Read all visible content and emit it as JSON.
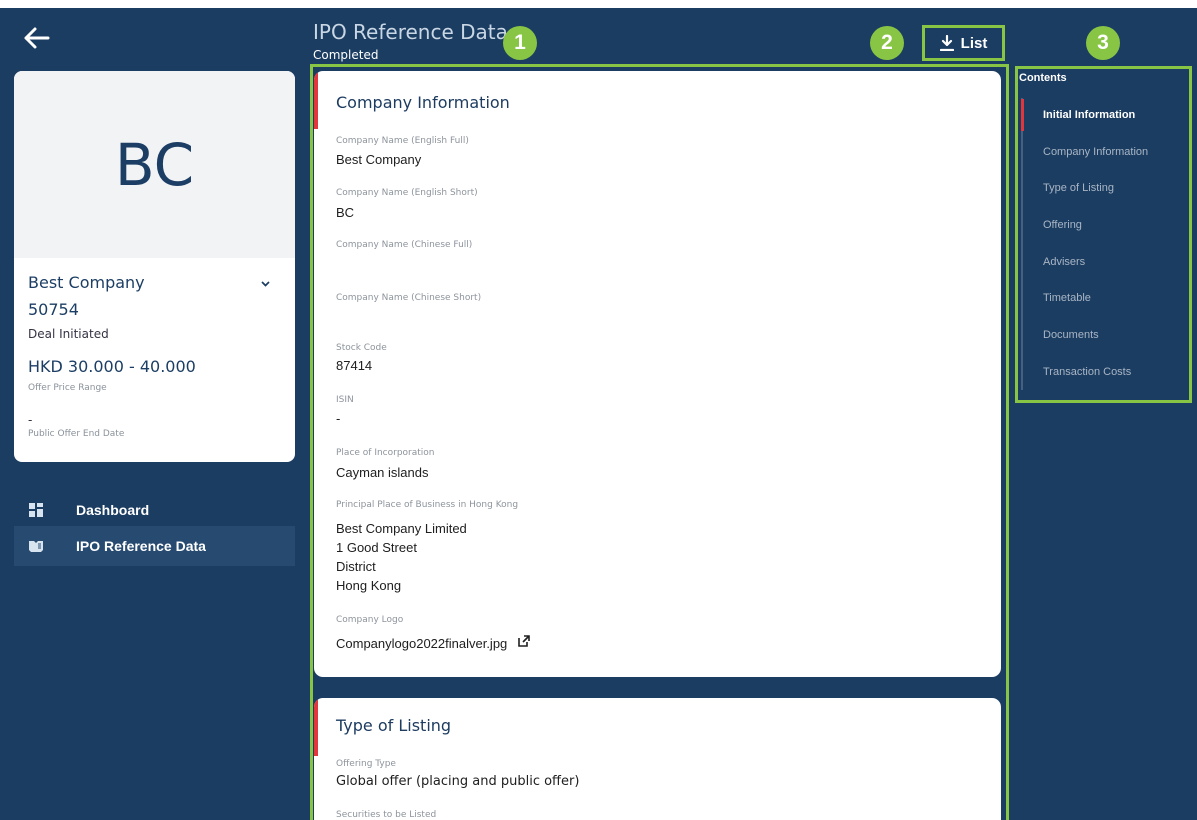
{
  "header": {
    "title": "IPO Reference Data",
    "status": "Completed",
    "list_label": "List"
  },
  "annotations": [
    "1",
    "2",
    "3"
  ],
  "profile": {
    "initials": "BC",
    "company_name": "Best Company",
    "deal_id": "50754",
    "deal_status": "Deal Initiated",
    "offer_price_range": "HKD 30.000 - 40.000",
    "offer_price_range_label": "Offer Price Range",
    "public_offer_end_date": "-",
    "public_offer_end_date_label": "Public Offer End Date"
  },
  "nav": [
    {
      "label": "Dashboard",
      "icon": "grid-icon"
    },
    {
      "label": "IPO Reference Data",
      "icon": "book-icon"
    }
  ],
  "company_information": {
    "title": "Company Information",
    "fields": [
      {
        "label": "Company Name (English Full)",
        "value": "Best Company"
      },
      {
        "label": "Company Name (English Short)",
        "value": "BC"
      },
      {
        "label": "Company Name (Chinese Full)",
        "value": ""
      },
      {
        "label": "Company Name (Chinese Short)",
        "value": ""
      },
      {
        "label": "Stock Code",
        "value": "87414"
      },
      {
        "label": "ISIN",
        "value": "-"
      },
      {
        "label": "Place of Incorporation",
        "value": "Cayman islands"
      },
      {
        "label": "Principal Place of Business in Hong Kong",
        "lines": [
          "Best Company Limited",
          "1 Good Street",
          "District",
          "Hong Kong"
        ]
      },
      {
        "label": "Company Logo",
        "value": "Companylogo2022finalver.jpg"
      }
    ]
  },
  "type_of_listing": {
    "title": "Type of Listing",
    "offering_type_label": "Offering Type",
    "offering_type": "Global offer (placing and public offer)",
    "securities_label": "Securities to be Listed"
  },
  "contents": {
    "title": "Contents",
    "items": [
      "Initial Information",
      "Company Information",
      "Type of Listing",
      "Offering",
      "Advisers",
      "Timetable",
      "Documents",
      "Transaction Costs"
    ]
  },
  "colors": {
    "navy": "#1b3d62",
    "green_annotation": "#88c545",
    "red_accent": "#e1363d"
  }
}
